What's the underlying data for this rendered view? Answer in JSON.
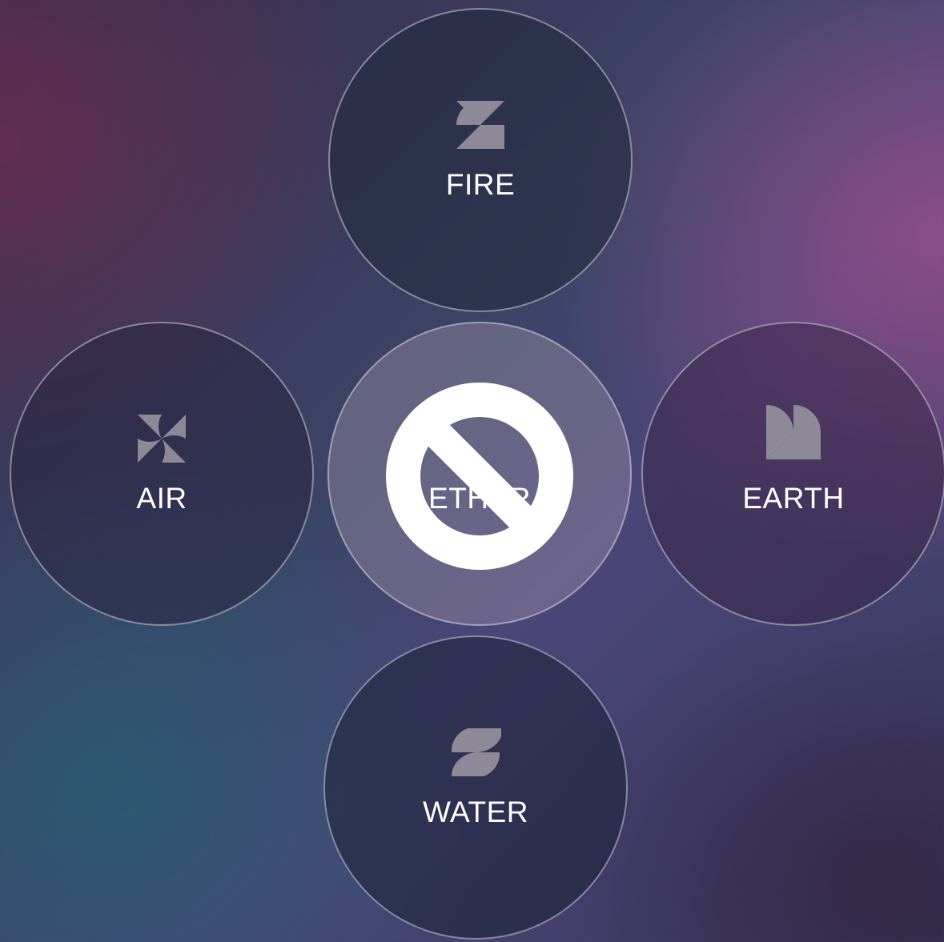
{
  "elements": [
    {
      "id": "fire",
      "label": "FIRE",
      "icon": "fire-glyph-icon"
    },
    {
      "id": "air",
      "label": "AIR",
      "icon": "air-glyph-icon"
    },
    {
      "id": "ether",
      "label": "ETHER",
      "icon": "none",
      "state": "disabled"
    },
    {
      "id": "earth",
      "label": "EARTH",
      "icon": "earth-glyph-icon"
    },
    {
      "id": "water",
      "label": "WATER",
      "icon": "water-glyph-icon"
    }
  ],
  "overlay": {
    "icon": "prohibited-icon",
    "color": "#ffffff"
  },
  "colors": {
    "glyph": "#8d8996",
    "label": "#ffffff",
    "ring": "#d2d2e1"
  }
}
